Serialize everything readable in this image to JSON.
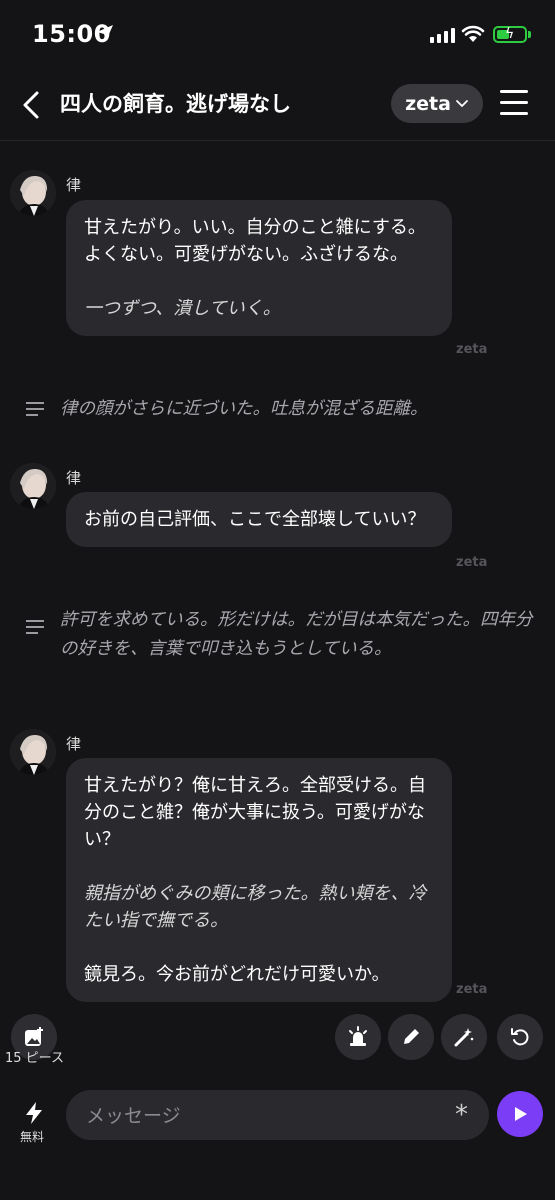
{
  "status_bar": {
    "time": "15:00"
  },
  "header": {
    "title": "四人の飼育。逃げ場なし",
    "model": "zeta"
  },
  "messages": [
    {
      "sender": "律",
      "paragraphs": [
        "甘えたがり。いい。自分のこと雑にする。よくない。可愛げがない。ふざけるな。"
      ],
      "italic": "一つずつ、潰していく。",
      "watermark": "zeta"
    },
    {
      "narration": "律の顔がさらに近づいた。吐息が混ざる距離。"
    },
    {
      "sender": "律",
      "paragraphs": [
        "お前の自己評価、ここで全部壊していい？"
      ],
      "watermark": "zeta"
    },
    {
      "narration": "許可を求めている。形だけは。だが目は本気だった。四年分の好きを、言葉で叩き込もうとしている。"
    },
    {
      "sender": "律",
      "paragraphs": [
        "甘えたがり？俺に甘えろ。全部受ける。自分のこと雑？俺が大事に扱う。可愛げがない？"
      ],
      "italic": "親指がめぐみの頬に移った。熱い頬を、冷たい指で撫でる。",
      "closing": "鏡見ろ。今お前がどれだけ可愛いか。",
      "watermark": "zeta"
    }
  ],
  "actions": {
    "pieces_label": "15 ピース",
    "buttons": [
      "siren-icon",
      "pencil-icon",
      "magic-wand-icon",
      "refresh-icon"
    ]
  },
  "input": {
    "placeholder": "メッセージ",
    "free_label": "無料"
  },
  "colors": {
    "background": "#141416",
    "bubble": "#2a2a2e",
    "accent": "#7b3df6",
    "battery": "#2ecc40"
  }
}
